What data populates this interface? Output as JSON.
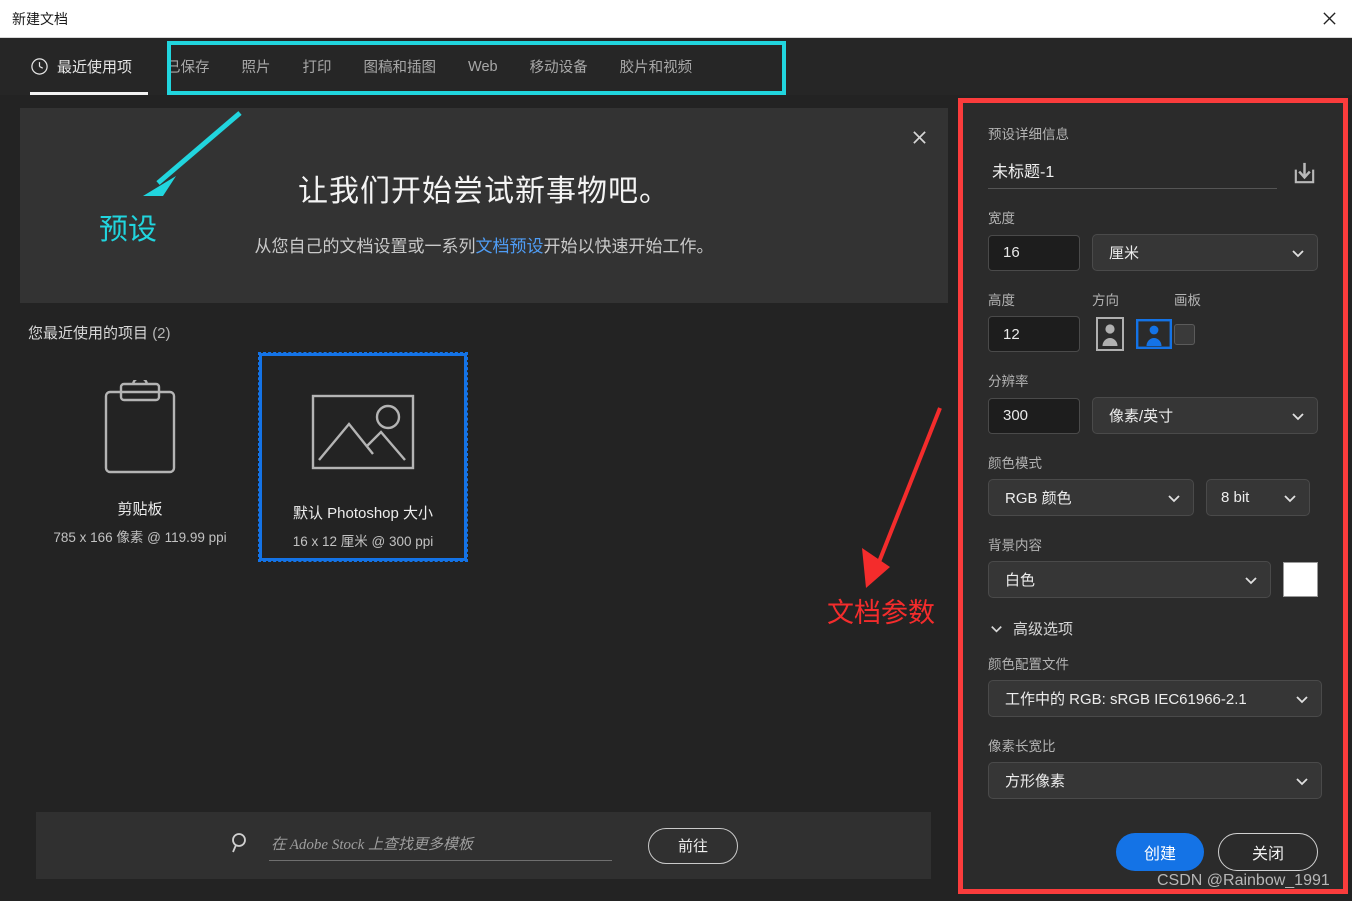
{
  "window": {
    "title": "新建文档",
    "close_icon": "close-icon"
  },
  "tabbar": {
    "recent_label": "最近使用项",
    "recent_icon": "clock-icon",
    "tabs": [
      {
        "label": "已保存"
      },
      {
        "label": "照片"
      },
      {
        "label": "打印"
      },
      {
        "label": "图稿和插图"
      },
      {
        "label": "Web"
      },
      {
        "label": "移动设备"
      },
      {
        "label": "胶片和视频"
      }
    ]
  },
  "banner": {
    "title": "让我们开始尝试新事物吧。",
    "sub_before": "从您自己的文档设置或一系列",
    "sub_link": "文档预设",
    "sub_after": "开始以快速开始工作。",
    "close_icon": "close-icon"
  },
  "recent": {
    "heading": "您最近使用的项目",
    "count": "(2)",
    "items": [
      {
        "name": "剪贴板",
        "meta": "785 x 166 像素 @ 119.99 ppi",
        "icon": "clipboard-icon",
        "selected": false
      },
      {
        "name": "默认 Photoshop 大小",
        "meta": "16 x 12 厘米 @ 300 ppi",
        "icon": "image-icon",
        "selected": true
      }
    ]
  },
  "stock": {
    "search_icon": "search-icon",
    "placeholder": "在 Adobe Stock 上查找更多模板",
    "value": "",
    "go_label": "前往"
  },
  "preset_panel": {
    "section_title": "预设详细信息",
    "preset_name": "未标题-1",
    "preset_name_placeholder": "未标题-1",
    "save_preset_icon": "download-icon",
    "width": {
      "label": "宽度",
      "value": "16",
      "unit": "厘米"
    },
    "height": {
      "label": "高度",
      "value": "12"
    },
    "orientation": {
      "label": "方向",
      "portrait_icon": "portrait-orientation-icon",
      "landscape_icon": "landscape-orientation-icon",
      "selected": "landscape"
    },
    "artboard": {
      "label": "画板",
      "checked": false
    },
    "resolution": {
      "label": "分辨率",
      "value": "300",
      "unit": "像素/英寸"
    },
    "color_mode": {
      "label": "颜色模式",
      "value": "RGB 颜色",
      "depth": "8 bit"
    },
    "background": {
      "label": "背景内容",
      "value": "白色",
      "swatch_color": "#ffffff"
    },
    "advanced": {
      "label": "高级选项",
      "expanded": true
    },
    "color_profile": {
      "label": "颜色配置文件",
      "value": "工作中的 RGB: sRGB IEC61966-2.1"
    },
    "pixel_aspect": {
      "label": "像素长宽比",
      "value": "方形像素"
    },
    "create_label": "创建",
    "close_label": "关闭"
  },
  "annotations": {
    "preset_text": "预设",
    "preset_color": "#21d5de",
    "document_params_text": "文档参数",
    "document_params_color": "#f42c2c",
    "watermark": "CSDN @Rainbow_1991"
  },
  "colors": {
    "accent_blue": "#1473e6",
    "cyan_highlight": "#21d5de",
    "red_highlight": "#fa3c3c",
    "panel_bg": "#2b2b2b",
    "app_bg": "#232323"
  }
}
